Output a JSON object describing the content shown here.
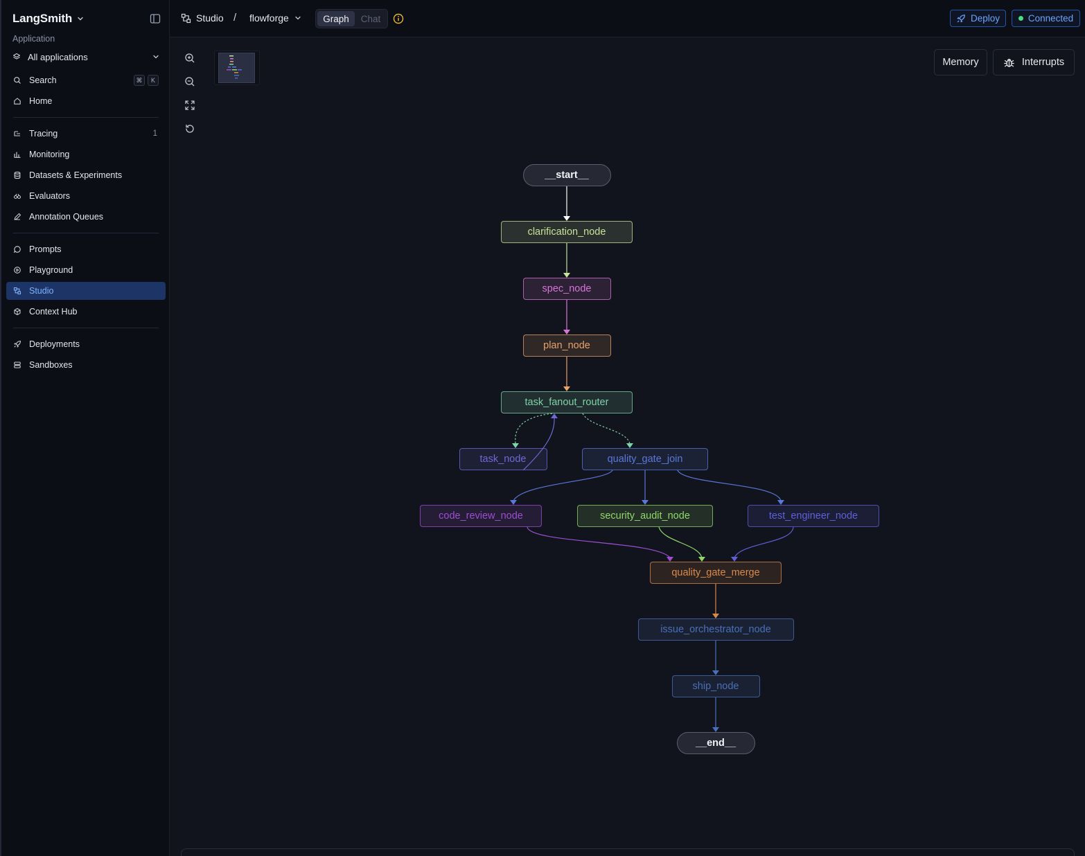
{
  "sidebar": {
    "brand": "LangSmith",
    "section_label": "Application",
    "app_select": "All applications",
    "search": {
      "label": "Search",
      "shortcut": [
        "⌘",
        "K"
      ]
    },
    "home": "Home",
    "group1": [
      {
        "label": "Tracing",
        "count": "1",
        "icon": "tracing-icon"
      },
      {
        "label": "Monitoring",
        "icon": "monitoring-icon"
      },
      {
        "label": "Datasets & Experiments",
        "icon": "database-icon"
      },
      {
        "label": "Evaluators",
        "icon": "evaluators-icon"
      },
      {
        "label": "Annotation Queues",
        "icon": "pencil-icon"
      }
    ],
    "group2": [
      {
        "label": "Prompts",
        "icon": "prompts-icon"
      },
      {
        "label": "Playground",
        "icon": "playground-icon"
      },
      {
        "label": "Studio",
        "icon": "studio-icon",
        "active": true
      },
      {
        "label": "Context Hub",
        "icon": "hub-icon"
      }
    ],
    "group3": [
      {
        "label": "Deployments",
        "icon": "rocket-icon"
      },
      {
        "label": "Sandboxes",
        "icon": "sandbox-icon"
      }
    ]
  },
  "topbar": {
    "studio": "Studio",
    "separator": "/",
    "project": "flowforge",
    "view_graph": "Graph",
    "view_chat": "Chat",
    "deploy": "Deploy",
    "status": "Connected"
  },
  "canvas": {
    "memory": "Memory",
    "interrupts": "Interrupts"
  },
  "graph": {
    "nodes": [
      {
        "id": "start",
        "label": "__start__"
      },
      {
        "id": "clarification",
        "label": "clarification_node"
      },
      {
        "id": "spec",
        "label": "spec_node"
      },
      {
        "id": "plan",
        "label": "plan_node"
      },
      {
        "id": "router",
        "label": "task_fanout_router"
      },
      {
        "id": "task",
        "label": "task_node"
      },
      {
        "id": "qgjoin",
        "label": "quality_gate_join"
      },
      {
        "id": "review",
        "label": "code_review_node"
      },
      {
        "id": "audit",
        "label": "security_audit_node"
      },
      {
        "id": "tester",
        "label": "test_engineer_node"
      },
      {
        "id": "merge",
        "label": "quality_gate_merge"
      },
      {
        "id": "orch",
        "label": "issue_orchestrator_node"
      },
      {
        "id": "ship",
        "label": "ship_node"
      },
      {
        "id": "end",
        "label": "__end__"
      }
    ],
    "colors": {
      "start": "#c9ccd6",
      "clarification": "#c8e39a",
      "spec": "#d874d8",
      "plan": "#e8a26a",
      "router": "#7fd3a8",
      "task": "#6d6ad8",
      "qgjoin": "#5a78d8",
      "review": "#9b4fd0",
      "audit": "#8fd86a",
      "tester": "#5f5fd8",
      "merge": "#d88a4a",
      "orch": "#4a6fb8",
      "ship": "#4a6fb8"
    }
  }
}
